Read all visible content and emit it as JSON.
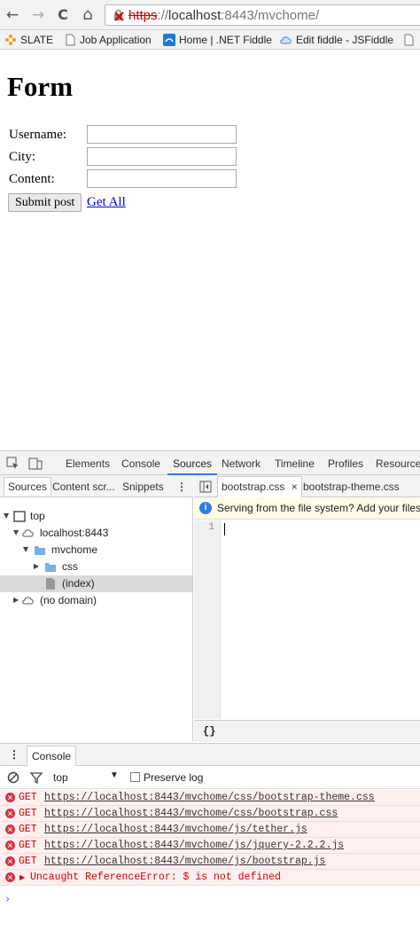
{
  "browser": {
    "back_icon": "←",
    "forward_icon": "→",
    "reload_icon": "C",
    "home_icon": "⌂",
    "url_protocol": "https",
    "url_sep": "://",
    "url_host": "localhost",
    "url_port": ":8443",
    "url_path": "/mvchome/"
  },
  "bookmarks": [
    {
      "label": "SLATE",
      "icon": "slate-icon"
    },
    {
      "label": "Job Application",
      "icon": "page-icon"
    },
    {
      "label": "Home | .NET Fiddle",
      "icon": "dotnetfiddle-icon"
    },
    {
      "label": "Edit fiddle - JSFiddle",
      "icon": "jsfiddle-icon"
    }
  ],
  "page": {
    "title": "Form",
    "fields": [
      {
        "label": "Username:",
        "value": ""
      },
      {
        "label": "City:",
        "value": ""
      },
      {
        "label": "Content:",
        "value": ""
      }
    ],
    "submit_label": "Submit post",
    "get_all_label": "Get All"
  },
  "devtools": {
    "tabs": [
      "Elements",
      "Console",
      "Sources",
      "Network",
      "Timeline",
      "Profiles",
      "Resources"
    ],
    "active_tab": "Sources",
    "sub_tabs": [
      "Sources",
      "Content scr...",
      "Snippets"
    ],
    "tree": [
      {
        "label": "top",
        "icon": "frame-icon",
        "indent": 0,
        "arrow": "▼"
      },
      {
        "label": "localhost:8443",
        "icon": "cloud-icon",
        "indent": 1,
        "arrow": "▼"
      },
      {
        "label": "mvchome",
        "icon": "folder-icon",
        "indent": 2,
        "arrow": "▼"
      },
      {
        "label": "css",
        "icon": "folder-icon",
        "indent": 3,
        "arrow": "▶"
      },
      {
        "label": "(index)",
        "icon": "file-icon",
        "indent": 3,
        "arrow": ""
      },
      {
        "label": "(no domain)",
        "icon": "cloud-icon",
        "indent": 1,
        "arrow": "▶"
      }
    ],
    "file_tabs": [
      "bootstrap.css",
      "bootstrap-theme.css"
    ],
    "info_message": "Serving from the file system? Add your files i",
    "line_number": "1",
    "pretty_print": "{}",
    "drawer_tab": "Console",
    "console_context": "top",
    "preserve_log_label": "Preserve log",
    "messages": [
      {
        "method": "GET",
        "url": "https://localhost:8443/mvchome/css/bootstrap-theme.css"
      },
      {
        "method": "GET",
        "url": "https://localhost:8443/mvchome/css/bootstrap.css"
      },
      {
        "method": "GET",
        "url": "https://localhost:8443/mvchome/js/tether.js"
      },
      {
        "method": "GET",
        "url": "https://localhost:8443/mvchome/js/jquery-2.2.2.js"
      },
      {
        "method": "GET",
        "url": "https://localhost:8443/mvchome/js/bootstrap.js"
      }
    ],
    "error_text": "Uncaught ReferenceError: $ is not defined",
    "prompt": "›"
  }
}
